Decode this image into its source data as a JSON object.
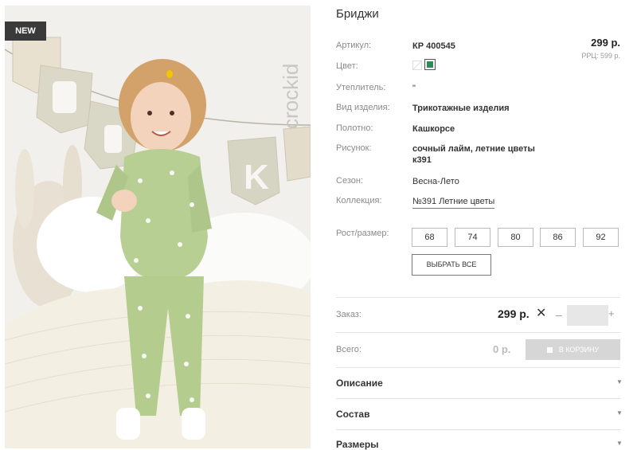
{
  "badge": "NEW",
  "brand_text": "crockid",
  "product": {
    "title": "Бриджи",
    "price": "299 р.",
    "rrp": "РРЦ: 599 р."
  },
  "specs": [
    {
      "label": "Артикул:",
      "value": "КР 400545"
    },
    {
      "label": "Цвет:",
      "value": ""
    },
    {
      "label": "Утеплитель:",
      "value": "\""
    },
    {
      "label": "Вид изделия:",
      "value": "Трикотажные изделия"
    },
    {
      "label": "Полотно:",
      "value": "Кашкорсе"
    },
    {
      "label": "Рисунок:",
      "value": "сочный лайм, летние цветы",
      "value2": "к391"
    },
    {
      "label": "Сезон:",
      "value": "Весна-Лето"
    },
    {
      "label": "Коллекция:",
      "value": "№391 Летние цветы"
    }
  ],
  "swatch_color": "#2e8b57",
  "size_label": "Рост/размер:",
  "sizes": [
    "68",
    "74",
    "80",
    "86",
    "92"
  ],
  "select_all": "ВЫБРАТЬ ВСЕ",
  "order": {
    "label": "Заказ:",
    "price": "299 р.",
    "remove": "✕",
    "minus": "–",
    "plus": "+"
  },
  "total": {
    "label": "Всего:",
    "value": "0 р.",
    "cart_button": "В КОРЗИНУ"
  },
  "accordion": [
    {
      "label": "Описание"
    },
    {
      "label": "Состав"
    },
    {
      "label": "Размеры"
    }
  ],
  "arrow_icon": "▼"
}
